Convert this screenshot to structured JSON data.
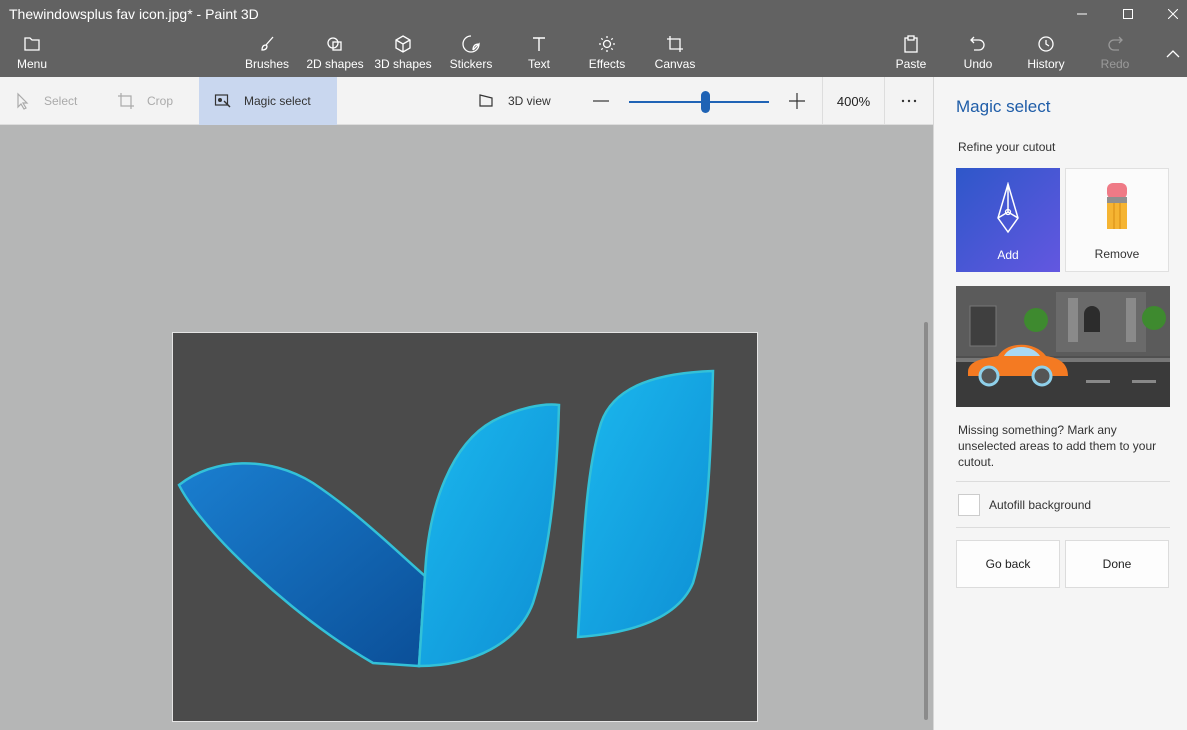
{
  "window": {
    "title": "Thewindowsplus fav icon.jpg* - Paint 3D"
  },
  "ribbon": {
    "menu_label": "Menu",
    "tools": [
      {
        "label": "Brushes",
        "icon": "brush-icon"
      },
      {
        "label": "2D shapes",
        "icon": "2d-shapes-icon"
      },
      {
        "label": "3D shapes",
        "icon": "3d-shapes-icon"
      },
      {
        "label": "Stickers",
        "icon": "stickers-icon"
      },
      {
        "label": "Text",
        "icon": "text-icon"
      },
      {
        "label": "Effects",
        "icon": "effects-icon"
      },
      {
        "label": "Canvas",
        "icon": "canvas-icon"
      }
    ],
    "paste_label": "Paste",
    "undo_label": "Undo",
    "history_label": "History",
    "redo_label": "Redo"
  },
  "toolbar": {
    "select_label": "Select",
    "crop_label": "Crop",
    "magic_select_label": "Magic select",
    "view3d_label": "3D view",
    "zoom_value": "400%",
    "zoom_slider_fraction": 0.54
  },
  "panel": {
    "title": "Magic select",
    "subtitle": "Refine your cutout",
    "add_label": "Add",
    "remove_label": "Remove",
    "hint": "Missing something? Mark any unselected areas to add them to your cutout.",
    "autofill_label": "Autofill background",
    "autofill_checked": false,
    "go_back_label": "Go back",
    "done_label": "Done"
  },
  "colors": {
    "accent": "#1f5da8",
    "ribbon_bg": "#626262",
    "canvas_bg": "#4b4b4b",
    "logo_dark": "#0b5aa4",
    "logo_light": "#12aee8",
    "selection_outline": "#33c1d8"
  }
}
